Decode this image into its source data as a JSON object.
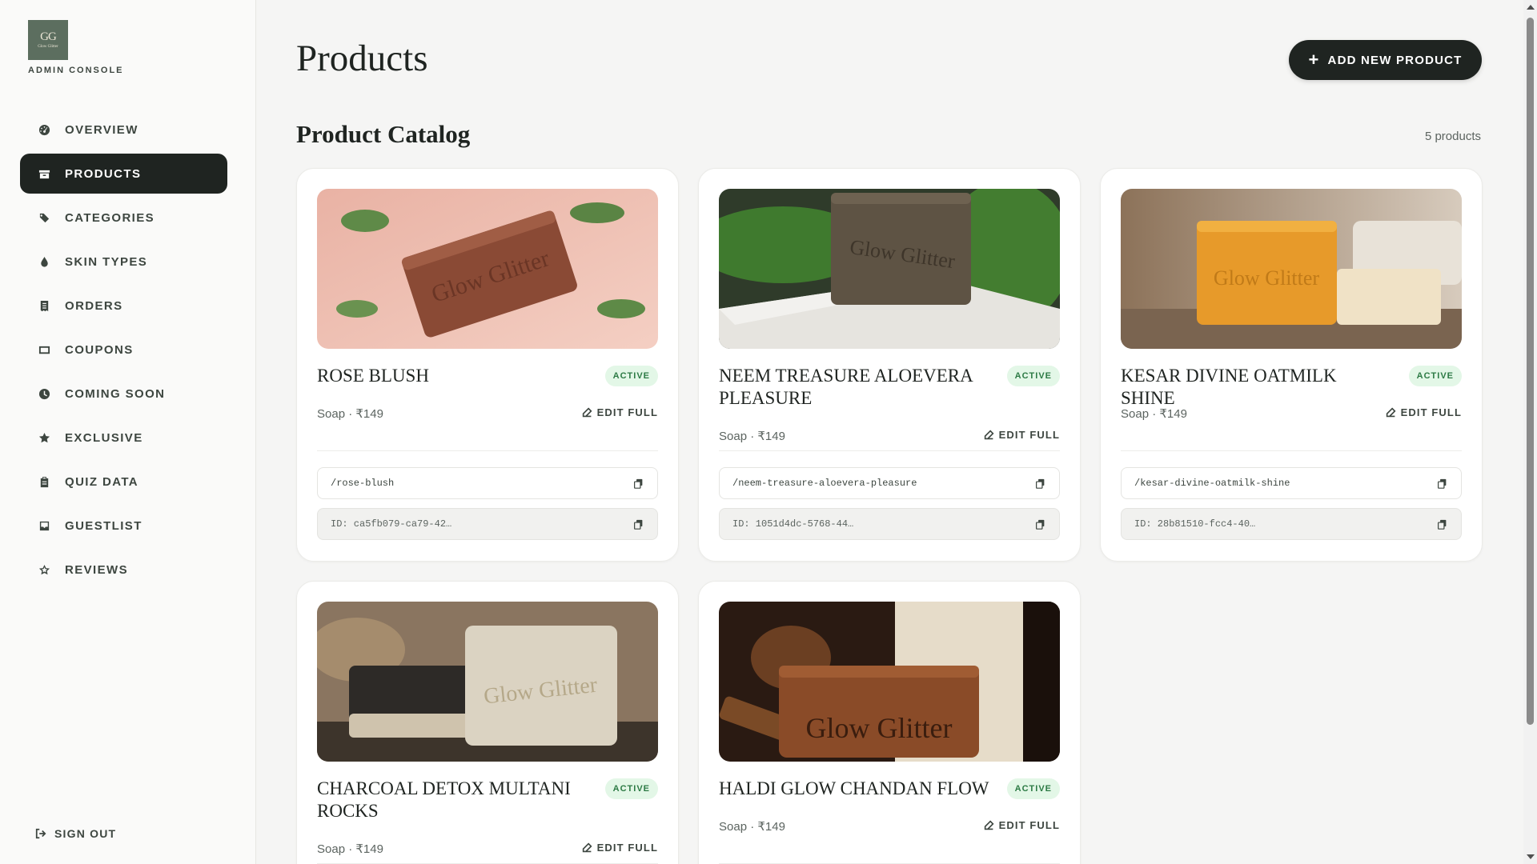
{
  "brand": {
    "monogram": "GG",
    "wordmark": "Glow Glitter",
    "console_label": "ADMIN CONSOLE"
  },
  "nav": {
    "items": [
      {
        "label": "OVERVIEW",
        "icon": "gauge-icon",
        "active": false
      },
      {
        "label": "PRODUCTS",
        "icon": "box-icon",
        "active": true
      },
      {
        "label": "CATEGORIES",
        "icon": "tags-icon",
        "active": false
      },
      {
        "label": "SKIN TYPES",
        "icon": "droplet-icon",
        "active": false
      },
      {
        "label": "ORDERS",
        "icon": "receipt-icon",
        "active": false
      },
      {
        "label": "COUPONS",
        "icon": "ticket-icon",
        "active": false
      },
      {
        "label": "COMING SOON",
        "icon": "clock-icon",
        "active": false
      },
      {
        "label": "EXCLUSIVE",
        "icon": "star-icon",
        "active": false
      },
      {
        "label": "QUIZ DATA",
        "icon": "clipboard-icon",
        "active": false
      },
      {
        "label": "GUESTLIST",
        "icon": "inbox-icon",
        "active": false
      },
      {
        "label": "REVIEWS",
        "icon": "star-outline-icon",
        "active": false
      }
    ],
    "signout_label": "SIGN OUT"
  },
  "header": {
    "title": "Products",
    "add_button_label": "ADD NEW PRODUCT"
  },
  "catalog": {
    "title": "Product Catalog",
    "count_label": "5 products",
    "products": [
      {
        "name": "ROSE BLUSH",
        "status": "ACTIVE",
        "meta": "Soap · ₹149",
        "edit_label": "EDIT FULL",
        "slug": "/rose-blush",
        "id": "ID: ca5fb079-ca79-42…",
        "image": "rose-soap"
      },
      {
        "name": "NEEM TREASURE ALOEVERA PLEASURE",
        "status": "ACTIVE",
        "meta": "Soap · ₹149",
        "edit_label": "EDIT FULL",
        "slug": "/neem-treasure-aloevera-pleasure",
        "id": "ID: 1051d4dc-5768-44…",
        "image": "neem-soap"
      },
      {
        "name": "KESAR DIVINE OATMILK SHINE",
        "status": "ACTIVE",
        "meta": "Soap · ₹149",
        "edit_label": "EDIT FULL",
        "slug": "/kesar-divine-oatmilk-shine",
        "id": "ID: 28b81510-fcc4-40…",
        "image": "kesar-soap"
      },
      {
        "name": "CHARCOAL DETOX MULTANI ROCKS",
        "status": "ACTIVE",
        "meta": "Soap · ₹149",
        "edit_label": "EDIT FULL",
        "image": "charcoal-soap"
      },
      {
        "name": "HALDI GLOW CHANDAN FLOW",
        "status": "ACTIVE",
        "meta": "Soap · ₹149",
        "edit_label": "EDIT FULL",
        "image": "haldi-soap"
      }
    ]
  },
  "colors": {
    "primary": "#1f2421",
    "badge_bg": "#e3f7e7",
    "badge_text": "#2c7a44",
    "page_bg": "#f5f5f4"
  }
}
